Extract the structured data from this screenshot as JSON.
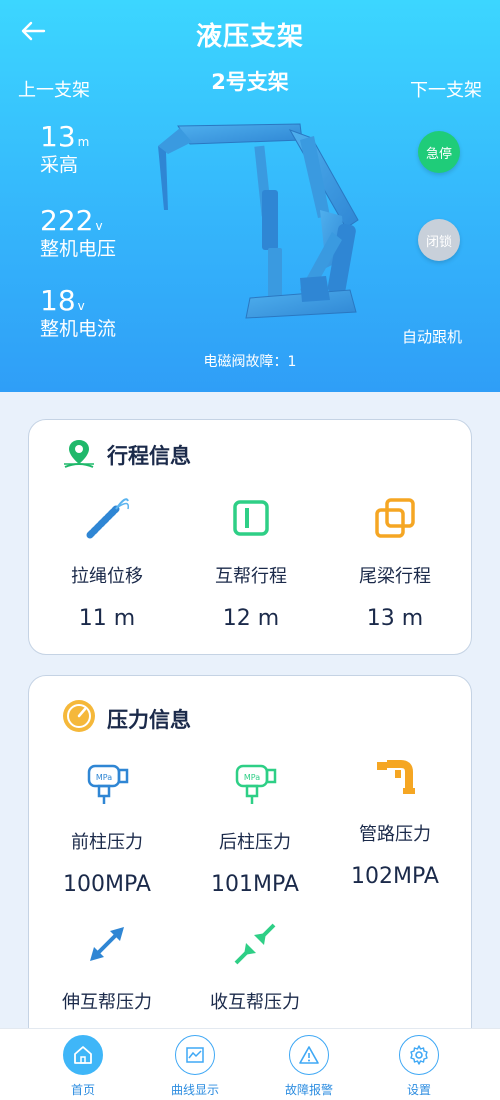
{
  "header": {
    "title": "液压支架",
    "prev_label": "上一支架",
    "next_label": "下一支架",
    "support_name": "2号支架",
    "stats": {
      "height": {
        "value": "13",
        "unit": "m",
        "label": "采高"
      },
      "voltage": {
        "value": "222",
        "unit": "v",
        "label": "整机电压"
      },
      "current": {
        "value": "18",
        "unit": "v",
        "label": "整机电流"
      }
    },
    "estop_label": "急停",
    "lock_label": "闭锁",
    "auto_follow_label": "自动跟机",
    "fault_text": "电磁阀故障：1"
  },
  "travel": {
    "title": "行程信息",
    "items": [
      {
        "label": "拉绳位移",
        "value": "11 m",
        "icon": "rope-spring-icon"
      },
      {
        "label": "互帮行程",
        "value": "12 m",
        "icon": "panel-icon"
      },
      {
        "label": "尾梁行程",
        "value": "13 m",
        "icon": "overlap-squares-icon"
      }
    ]
  },
  "pressure": {
    "title": "压力信息",
    "items": [
      {
        "label": "前柱压力",
        "value": "100MPA",
        "icon": "pressure-gauge-icon"
      },
      {
        "label": "后柱压力",
        "value": "101MPA",
        "icon": "pressure-gauge-icon"
      },
      {
        "label": "管路压力",
        "value": "102MPA",
        "icon": "pipe-icon"
      },
      {
        "label": "伸互帮压力",
        "icon": "expand-arrows-icon"
      },
      {
        "label": "收互帮压力",
        "icon": "collapse-arrows-icon"
      }
    ]
  },
  "tabs": [
    {
      "label": "首页",
      "icon": "home-icon"
    },
    {
      "label": "曲线显示",
      "icon": "chart-icon"
    },
    {
      "label": "故障报警",
      "icon": "warning-icon"
    },
    {
      "label": "设置",
      "icon": "gear-icon"
    }
  ],
  "colors": {
    "header_top": "#3cd6ff",
    "header_bottom": "#2f9ef7",
    "estop": "#1fcc79",
    "lock": "#c8d0da",
    "title_text": "#1b2a4a",
    "accent_blue": "#2d8de0"
  }
}
